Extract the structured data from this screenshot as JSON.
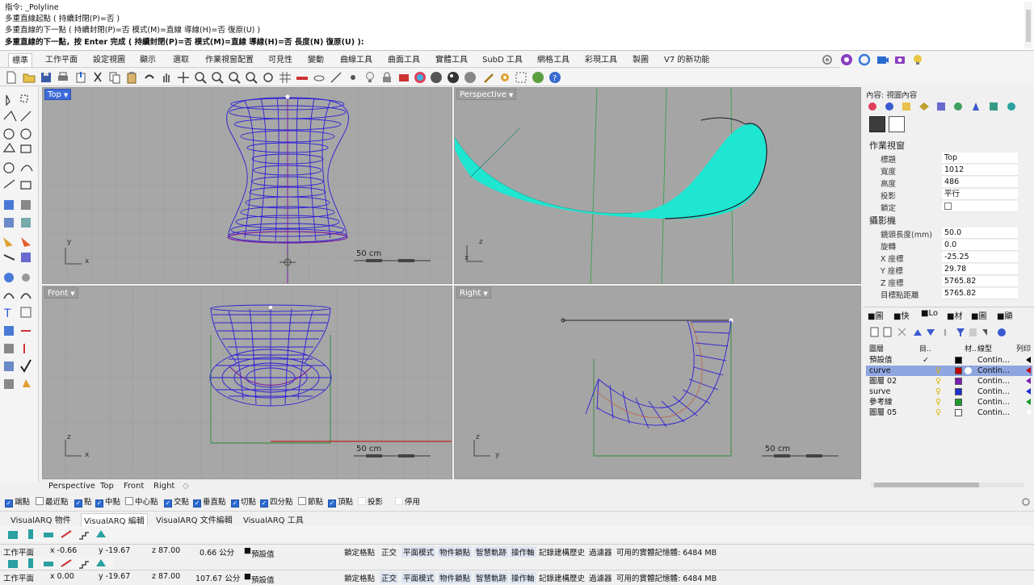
{
  "command_history": [
    "指令: _Polyline",
    "多重直線起點 ( 持續封閉(P)=否 )",
    "多重直線的下一點 ( 持續封閉(P)=否  模式(M)=直線  導線(H)=否  復原(U) )",
    "多重直線的下一點，按 Enter 完成 ( 持續封閉(P)=否  模式(M)=直線  導線(H)=否  長度(N)  復原(U) ):"
  ],
  "tabs": [
    "標準",
    "工作平面",
    "設定視圖",
    "顯示",
    "選取",
    "作業視窗配置",
    "可見性",
    "變動",
    "曲線工具",
    "曲面工具",
    "實體工具",
    "SubD 工具",
    "網格工具",
    "彩現工具",
    "製圖",
    "V7 的新功能"
  ],
  "viewports": {
    "top": {
      "label": "Top",
      "scale": "50 cm",
      "x_axis": "x",
      "y_axis": "y"
    },
    "perspective": {
      "label": "Perspective",
      "x_axis": "x",
      "z_axis": "z"
    },
    "front": {
      "label": "Front",
      "scale": "50 cm",
      "x_axis": "x",
      "z_axis": "z"
    },
    "right": {
      "label": "Right",
      "scale": "50 cm",
      "y_axis": "y",
      "z_axis": "z"
    }
  },
  "viewport_tabs": [
    "Perspective",
    "Top",
    "Front",
    "Right"
  ],
  "osnaps": [
    {
      "label": "端點",
      "on": true
    },
    {
      "label": "最近點",
      "on": false
    },
    {
      "label": "點",
      "on": true
    },
    {
      "label": "中點",
      "on": true
    },
    {
      "label": "中心點",
      "on": false
    },
    {
      "label": "交點",
      "on": true
    },
    {
      "label": "垂直點",
      "on": true
    },
    {
      "label": "切點",
      "on": true
    },
    {
      "label": "四分點",
      "on": true
    },
    {
      "label": "節點",
      "on": false
    },
    {
      "label": "頂點",
      "on": true
    },
    {
      "label": "投影",
      "on": false
    },
    {
      "label": "停用",
      "on": false
    }
  ],
  "vaq_tabs": [
    "VisualARQ 物件",
    "VisualARQ 編輯",
    "VisualARQ 文件編輯",
    "VisualARQ 工具"
  ],
  "status_rows": [
    {
      "cplane": "工作平面",
      "x": "x -0.66",
      "y": "y -19.67",
      "z": "z 87.00",
      "dist": "0.66 公分",
      "layer": "預設值"
    },
    {
      "cplane": "工作平面",
      "x": "x 0.00",
      "y": "y -19.67",
      "z": "z 87.00",
      "dist": "107.67 公分",
      "layer": "預設值"
    }
  ],
  "status_toggles": [
    "鎖定格點",
    "正交",
    "平面模式",
    "物件鎖點",
    "智慧軌跡",
    "操作軸",
    "記錄建構歷史",
    "過濾器",
    "可用的實體記憶體: 6484 MB"
  ],
  "properties": {
    "header": "內容: 視圖內容",
    "viewport_section": "作業視窗",
    "rows1": [
      {
        "k": "標題",
        "v": "Top"
      },
      {
        "k": "寬度",
        "v": "1012"
      },
      {
        "k": "高度",
        "v": "486"
      },
      {
        "k": "投影",
        "v": "平行"
      },
      {
        "k": "鎖定",
        "v": ""
      }
    ],
    "camera_section": "攝影機",
    "rows2": [
      {
        "k": "鏡頭長度(mm)",
        "v": "50.0"
      },
      {
        "k": "旋轉",
        "v": "0.0"
      },
      {
        "k": "X 座標",
        "v": "-25.25"
      },
      {
        "k": "Y 座標",
        "v": "29.78"
      },
      {
        "k": "Z 座標",
        "v": "5765.82"
      },
      {
        "k": "目標點距離",
        "v": "5765.82"
      }
    ]
  },
  "layers_panel": {
    "tabs": [
      "圖",
      "快",
      "Lo",
      "材",
      "圖",
      "顯"
    ],
    "columns": {
      "name": "圖層",
      "cur": "目..",
      "mat": "材..",
      "ltype": "線型",
      "print": "列印"
    },
    "rows": [
      {
        "name": "預設值",
        "color": "#000000",
        "ltype": "Contin...",
        "check": "✓",
        "sel": false
      },
      {
        "name": "curve",
        "color": "#c00000",
        "ltype": "Contin...",
        "check": "",
        "sel": true
      },
      {
        "name": "圖層 02",
        "color": "#7a1fb0",
        "ltype": "Contin...",
        "check": "",
        "sel": false
      },
      {
        "name": "surve",
        "color": "#1f2fd0",
        "ltype": "Contin...",
        "check": "",
        "sel": false
      },
      {
        "name": "參考線",
        "color": "#1a9a2a",
        "ltype": "Contin...",
        "check": "",
        "sel": false
      },
      {
        "name": "圖層 05",
        "color": "#ffffff",
        "ltype": "Contin...",
        "check": "",
        "sel": false
      }
    ]
  }
}
